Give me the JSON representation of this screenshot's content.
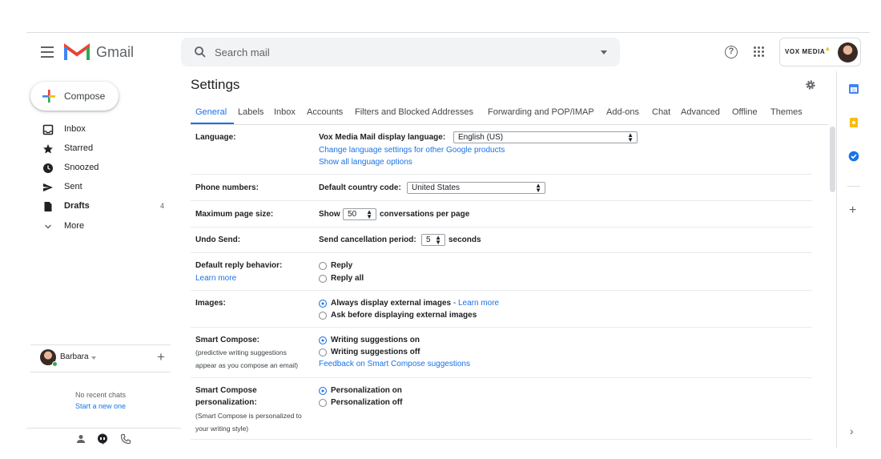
{
  "header": {
    "app_name": "Gmail",
    "search_placeholder": "Search mail",
    "brand": "VOX MEDIA"
  },
  "sidebar": {
    "compose_label": "Compose",
    "items": [
      {
        "label": "Inbox",
        "icon": "inbox-icon",
        "count": ""
      },
      {
        "label": "Starred",
        "icon": "star-icon",
        "count": ""
      },
      {
        "label": "Snoozed",
        "icon": "clock-icon",
        "count": ""
      },
      {
        "label": "Sent",
        "icon": "send-icon",
        "count": ""
      },
      {
        "label": "Drafts",
        "icon": "draft-icon",
        "count": "4"
      },
      {
        "label": "More",
        "icon": "chevron-down-icon",
        "count": ""
      }
    ],
    "user_name": "Barbara",
    "no_chats": "No recent chats",
    "start_chat": "Start a new one"
  },
  "main": {
    "title": "Settings",
    "tabs": [
      "General",
      "Labels",
      "Inbox",
      "Accounts",
      "Filters and Blocked Addresses",
      "Forwarding and POP/IMAP",
      "Add-ons",
      "Chat",
      "Advanced",
      "Offline",
      "Themes"
    ],
    "language": {
      "label": "Language:",
      "display_label": "Vox Media Mail display language:",
      "value": "English (US)",
      "link1": "Change language settings for other Google products",
      "link2": "Show all language options"
    },
    "phone": {
      "label": "Phone numbers:",
      "country_label": "Default country code:",
      "value": "United States"
    },
    "page_size": {
      "label": "Maximum page size:",
      "prefix": "Show",
      "value": "50",
      "suffix": "conversations per page"
    },
    "undo_send": {
      "label": "Undo Send:",
      "prefix": "Send cancellation period:",
      "value": "5",
      "suffix": "seconds"
    },
    "reply": {
      "label": "Default reply behavior:",
      "learn_more": "Learn more",
      "options": [
        "Reply",
        "Reply all"
      ],
      "selected": null
    },
    "images": {
      "label": "Images:",
      "options": [
        "Always display external images",
        "Ask before displaying external images"
      ],
      "separator": " - ",
      "learn_more": "Learn more",
      "selected": 0
    },
    "smart_compose": {
      "label": "Smart Compose:",
      "desc1": "(predictive writing suggestions",
      "desc2": "appear as you compose an email)",
      "options": [
        "Writing suggestions on",
        "Writing suggestions off"
      ],
      "feedback": "Feedback on Smart Compose suggestions",
      "selected": 0
    },
    "personalization": {
      "label1": "Smart Compose",
      "label2": "personalization:",
      "desc1": "(Smart Compose is personalized to",
      "desc2": "your writing style)",
      "options": [
        "Personalization on",
        "Personalization off"
      ],
      "selected": 0
    }
  },
  "colors": {
    "accent": "#1a73e8",
    "text": "#202124",
    "muted": "#5f6368"
  }
}
